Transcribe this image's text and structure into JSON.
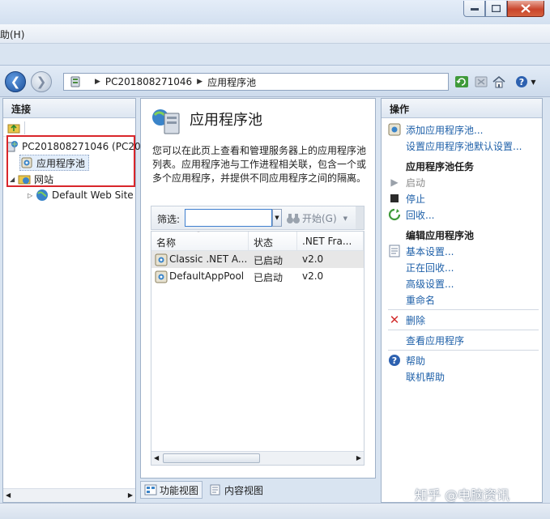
{
  "menubar": {
    "help_label": "助(H)"
  },
  "address": {
    "crumbs": [
      "PC201808271046",
      "应用程序池"
    ]
  },
  "connections": {
    "title": "连接",
    "tree": {
      "server": "PC201808271046 (PC20",
      "app_pools": "应用程序池",
      "sites": "网站",
      "default_site": "Default Web Site"
    }
  },
  "center": {
    "title": "应用程序池",
    "description": "您可以在此页上查看和管理服务器上的应用程序池列表。应用程序池与工作进程相关联，包含一个或多个应用程序，并提供不同应用程序之间的隔离。",
    "filter_label": "筛选:",
    "filter_value": "",
    "start_label": "开始(G)",
    "columns": [
      "名称",
      "状态",
      ".NET Fra..."
    ],
    "rows": [
      {
        "name": "Classic .NET A...",
        "status": "已启动",
        "net": "v2.0"
      },
      {
        "name": "DefaultAppPool",
        "status": "已启动",
        "net": "v2.0"
      }
    ],
    "view_tabs": {
      "features": "功能视图",
      "content": "内容视图"
    }
  },
  "actions": {
    "title": "操作",
    "add_pool": "添加应用程序池...",
    "set_defaults": "设置应用程序池默认设置...",
    "tasks_header": "应用程序池任务",
    "start": "启动",
    "stop": "停止",
    "recycle": "回收...",
    "edit_header": "编辑应用程序池",
    "basic_settings": "基本设置...",
    "recycling": "正在回收...",
    "advanced_settings": "高级设置...",
    "rename": "重命名",
    "delete": "删除",
    "view_apps": "查看应用程序",
    "help": "帮助",
    "online_help": "联机帮助"
  },
  "watermark": "知乎 @电脑资讯",
  "colors": {
    "accent_link": "#1d5fa8",
    "highlight_box": "#d9262b",
    "chrome": "#d9e4f1"
  }
}
